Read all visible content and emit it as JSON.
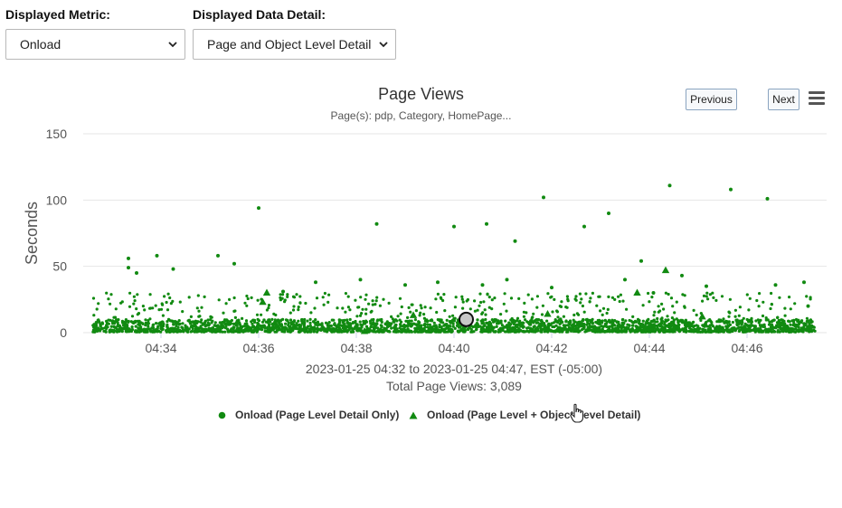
{
  "controls": {
    "metric": {
      "label": "Displayed Metric:",
      "value": "Onload"
    },
    "detail": {
      "label": "Displayed Data Detail:",
      "value": "Page and Object Level Detail"
    }
  },
  "chart": {
    "title": "Page Views",
    "subtitle": "Page(s): pdp, Category, HomePage...",
    "prev_label": "Previous",
    "next_label": "Next",
    "menu_icon": "hamburger-menu-icon",
    "range_text": "2023-01-25 04:32 to 2023-01-25 04:47, EST (-05:00)",
    "total_text": "Total Page Views: 3,089"
  },
  "colors": {
    "series": "#118a11",
    "marker_highlight": "#c8c8c8"
  },
  "chart_data": {
    "type": "scatter",
    "ylabel": "Seconds",
    "xlabel": "",
    "ylim": [
      0,
      150
    ],
    "yticks": [
      0,
      50,
      100,
      150
    ],
    "xlim": [
      "04:32:30",
      "04:47:30"
    ],
    "xticks": [
      "04:34",
      "04:36",
      "04:38",
      "04:40",
      "04:42",
      "04:44",
      "04:46"
    ],
    "grid": "horizontal",
    "legend_position": "bottom",
    "series": [
      {
        "name": "Onload (Page Level Detail Only)",
        "marker": "circle",
        "points": [
          [
            "04:33:20",
            56
          ],
          [
            "04:33:20",
            49
          ],
          [
            "04:33:30",
            45
          ],
          [
            "04:33:55",
            58
          ],
          [
            "04:34:15",
            48
          ],
          [
            "04:35:10",
            58
          ],
          [
            "04:35:30",
            52
          ],
          [
            "04:36:00",
            94
          ],
          [
            "04:38:25",
            82
          ],
          [
            "04:40:00",
            80
          ],
          [
            "04:40:40",
            82
          ],
          [
            "04:41:15",
            69
          ],
          [
            "04:41:50",
            102
          ],
          [
            "04:42:40",
            80
          ],
          [
            "04:43:10",
            90
          ],
          [
            "04:43:50",
            54
          ],
          [
            "04:44:25",
            111
          ],
          [
            "04:44:40",
            43
          ],
          [
            "04:45:40",
            108
          ],
          [
            "04:46:25",
            101
          ],
          [
            "04:36:30",
            31
          ],
          [
            "04:37:10",
            38
          ],
          [
            "04:38:05",
            40
          ],
          [
            "04:39:00",
            36
          ],
          [
            "04:39:40",
            38
          ],
          [
            "04:40:35",
            36
          ],
          [
            "04:41:05",
            40
          ],
          [
            "04:42:00",
            34
          ],
          [
            "04:43:30",
            40
          ],
          [
            "04:44:05",
            30
          ],
          [
            "04:45:10",
            35
          ],
          [
            "04:46:35",
            36
          ],
          [
            "04:47:10",
            38
          ],
          [
            "04:47:15",
            20
          ]
        ],
        "bulk": {
          "count": 2950,
          "typical_range": [
            0,
            10
          ],
          "occasional_range": [
            10,
            30
          ]
        }
      },
      {
        "name": "Onload (Page Level + Object Level Detail)",
        "marker": "triangle",
        "points": [
          [
            "04:36:10",
            30
          ],
          [
            "04:36:05",
            23
          ],
          [
            "04:39:10",
            13
          ],
          [
            "04:40:10",
            10
          ],
          [
            "04:41:55",
            14
          ],
          [
            "04:43:45",
            30
          ],
          [
            "04:44:20",
            47
          ],
          [
            "04:45:05",
            12
          ],
          [
            "04:33:10",
            3
          ],
          [
            "04:37:40",
            2
          ],
          [
            "04:38:10",
            1
          ],
          [
            "04:42:30",
            2
          ],
          [
            "04:44:50",
            6
          ],
          [
            "04:46:10",
            3
          ]
        ]
      }
    ],
    "highlighted_point": [
      "04:40:15",
      10
    ]
  },
  "legend": {
    "items": [
      {
        "label": "Onload (Page Level Detail Only)"
      },
      {
        "label": "Onload (Page Level + Object Level Detail)"
      }
    ]
  }
}
